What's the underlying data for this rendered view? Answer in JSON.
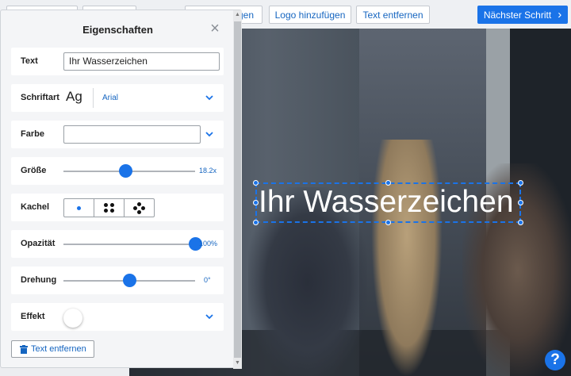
{
  "toolbar": {
    "btn1": "",
    "btn2": "",
    "btn3_partial": "gen",
    "add_logo": "Logo hinzufügen",
    "remove_text": "Text entfernen",
    "next_step": "Nächster Schritt"
  },
  "watermark": {
    "text": "Ihr Wasserzeichen"
  },
  "help": {
    "label": "?"
  },
  "panel": {
    "title": "Eigenschaften",
    "text_label": "Text",
    "text_value": "Ihr Wasserzeichen",
    "font_label": "Schriftart",
    "font_sample": "Ag",
    "font_name": "Arial",
    "color_label": "Farbe",
    "size_label": "Größe",
    "size_value": "18.2x",
    "size_fraction": 0.47,
    "tile_label": "Kachel",
    "opacity_label": "Opazität",
    "opacity_value": "100%",
    "opacity_fraction": 1.0,
    "rotation_label": "Drehung",
    "rotation_value": "0°",
    "rotation_fraction": 0.5,
    "effect_label": "Effekt",
    "remove_button": "Text entfernen"
  },
  "colors": {
    "accent": "#1a73e8",
    "link": "#1565c0"
  }
}
